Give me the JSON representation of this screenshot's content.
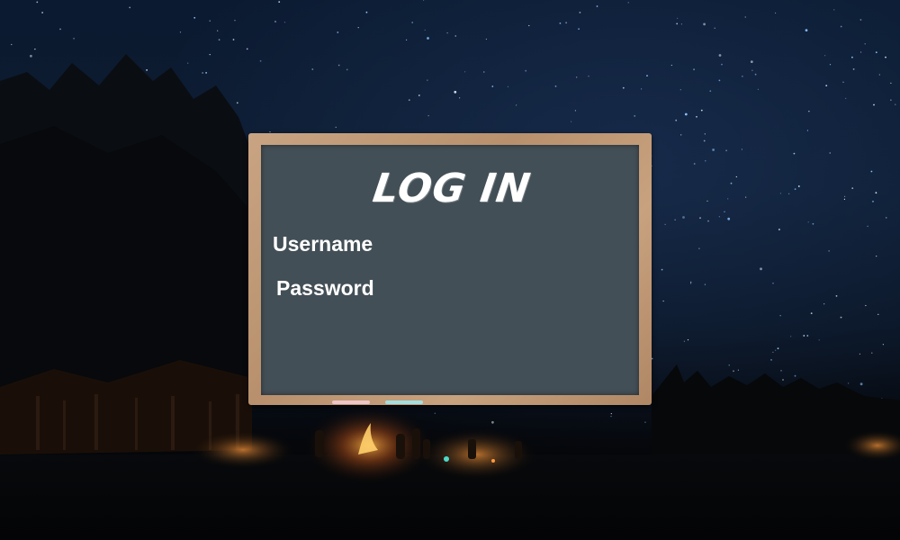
{
  "login": {
    "title": "LOG IN",
    "username_label": "Username",
    "password_label": "Password"
  },
  "colors": {
    "board_surface": "#434f56",
    "frame": "#c4a07f",
    "chalk_pink": "#efc6c6",
    "chalk_teal": "#a6dede",
    "text": "#ffffff"
  }
}
